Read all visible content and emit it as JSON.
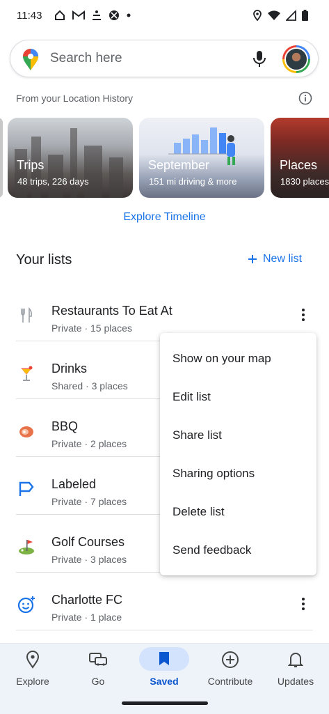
{
  "status_bar": {
    "time": "11:43"
  },
  "search": {
    "placeholder": "Search here"
  },
  "history": {
    "label": "From your Location History"
  },
  "cards": [
    {
      "title": "Trips",
      "subtitle": "48 trips,  226 days"
    },
    {
      "title": "September",
      "subtitle": "151 mi driving & more"
    },
    {
      "title": "Places",
      "subtitle": "1830 places"
    }
  ],
  "explore_timeline": "Explore Timeline",
  "lists_section": {
    "title": "Your lists",
    "new_list": "New list"
  },
  "lists": [
    {
      "name": "Restaurants To Eat At",
      "meta": "Private · 15 places",
      "icon": "utensils-icon"
    },
    {
      "name": "Drinks",
      "meta": "Shared · 3 places",
      "icon": "cocktail-icon"
    },
    {
      "name": "BBQ",
      "meta": "Private · 2 places",
      "icon": "meat-icon"
    },
    {
      "name": "Labeled",
      "meta": "Private · 7 places",
      "icon": "flag-label-icon"
    },
    {
      "name": "Golf Courses",
      "meta": "Private · 3 places",
      "icon": "golf-icon"
    },
    {
      "name": "Charlotte FC",
      "meta": "Private · 1 place",
      "icon": "smiley-add-icon"
    }
  ],
  "context_menu": [
    "Show on your map",
    "Edit list",
    "Share list",
    "Sharing options",
    "Delete list",
    "Send feedback"
  ],
  "bottom_nav": [
    {
      "label": "Explore",
      "icon": "location-pin-icon"
    },
    {
      "label": "Go",
      "icon": "car-icon"
    },
    {
      "label": "Saved",
      "icon": "bookmark-icon",
      "active": true
    },
    {
      "label": "Contribute",
      "icon": "add-circle-icon"
    },
    {
      "label": "Updates",
      "icon": "bell-icon"
    }
  ],
  "colors": {
    "accent": "#1a73e8",
    "active_nav": "#0b57d0",
    "nav_pill": "#d3e3fd",
    "nav_bg": "#eef2f9"
  }
}
